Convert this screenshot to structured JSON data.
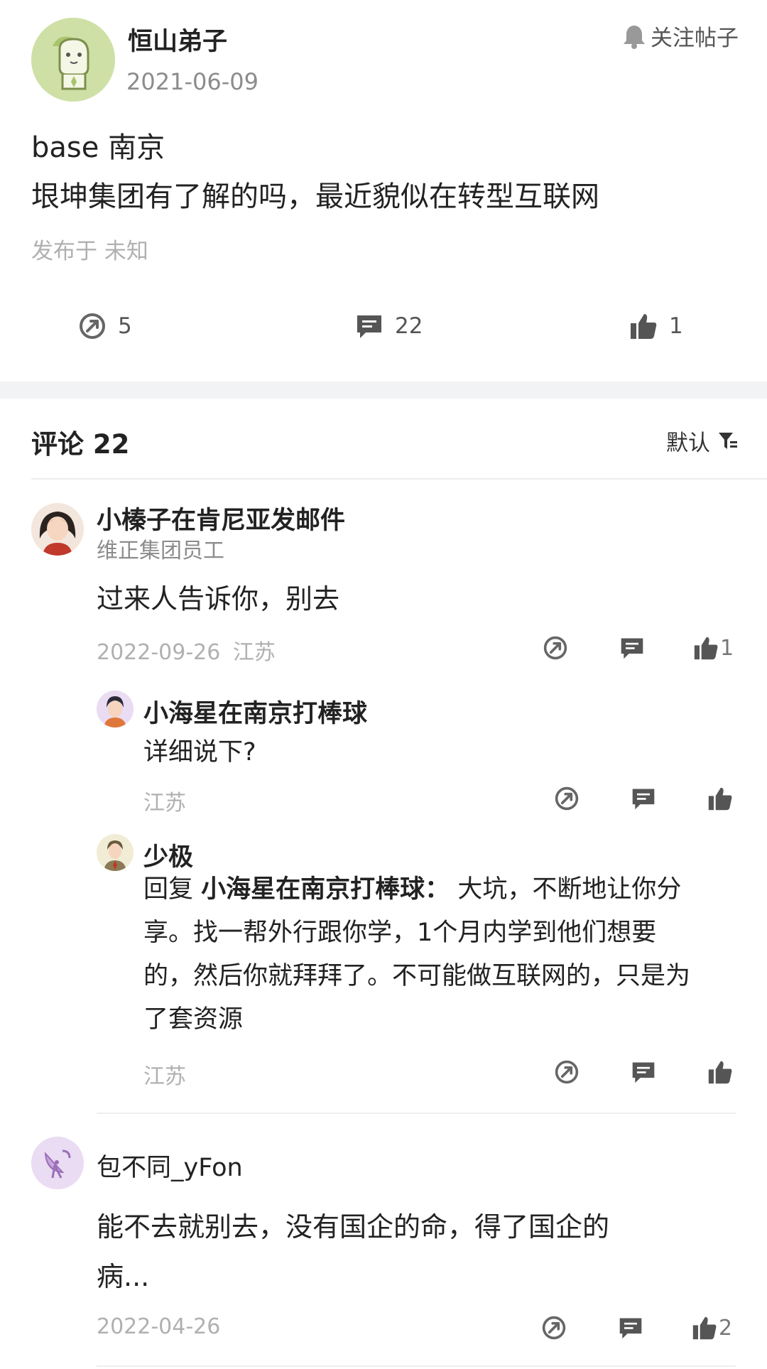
{
  "post": {
    "author": "恒山弟子",
    "date": "2021-06-09",
    "follow_label": "关注帖子",
    "line1": "base 南京",
    "line2": "垠坤集团有了解的吗，最近貌似在转型互联网",
    "meta": "发布于 未知",
    "share_count": "5",
    "comment_count": "22",
    "like_count": "1"
  },
  "comments_header": {
    "title": "评论 22",
    "sort_label": "默认"
  },
  "comments": [
    {
      "name": "小榛子在肯尼亚发邮件",
      "subtitle": "维正集团员工",
      "text": "过来人告诉你，别去",
      "date": "2022-09-26",
      "location": "江苏",
      "likes": "1",
      "replies": [
        {
          "name": "小海星在南京打棒球",
          "text": "详细说下?",
          "location": "江苏"
        },
        {
          "name": "少极",
          "reply_prefix": "回复",
          "reply_to": "小海星在南京打棒球：",
          "text_lines": [
            "大坑，不断地让你分",
            "享。找一帮外行跟你学，1个月内学到他们想要",
            "的，然后你就拜拜了。不可能做互联网的，只是为",
            "了套资源"
          ],
          "location": "江苏"
        }
      ]
    },
    {
      "name": "包不同_yFon",
      "text_lines": [
        "能不去就别去，没有国企的命，得了国企的",
        "病..."
      ],
      "date": "2022-04-26",
      "likes": "2"
    }
  ],
  "colors": {
    "divider": "#f2f3f5",
    "icon": "#666666",
    "muted": "#b0b0b0"
  }
}
